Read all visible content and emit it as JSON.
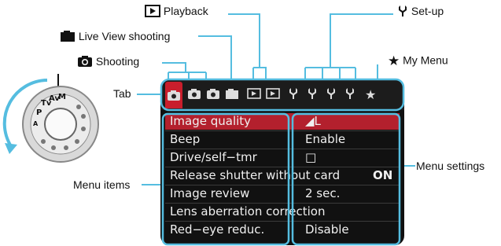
{
  "labels": {
    "playback": "Playback",
    "setup": "Set-up",
    "live_view": "Live View shooting",
    "shooting": "Shooting",
    "my_menu": "My Menu",
    "tab": "Tab",
    "menu_items": "Menu items",
    "menu_settings": "Menu settings"
  },
  "tabs": [
    {
      "icon": "camera-icon",
      "active": true
    },
    {
      "icon": "camera-icon"
    },
    {
      "icon": "camera-icon"
    },
    {
      "icon": "live-view-camera-icon"
    },
    {
      "icon": "playback-icon"
    },
    {
      "icon": "playback-icon"
    },
    {
      "icon": "wrench-icon"
    },
    {
      "icon": "wrench-icon"
    },
    {
      "icon": "wrench-icon"
    },
    {
      "icon": "wrench-icon"
    },
    {
      "icon": "star-icon"
    }
  ],
  "menu": [
    {
      "name": "Image quality",
      "value": "◢L"
    },
    {
      "name": "Beep",
      "value": "Enable"
    },
    {
      "name": "Drive/self−tmr",
      "value": "□"
    },
    {
      "name": "Release shutter without card",
      "value": "ON"
    },
    {
      "name": "Image review",
      "value": "2 sec."
    },
    {
      "name": "Lens aberration correction",
      "value": ""
    },
    {
      "name": "Red−eye reduc.",
      "value": "Disable"
    }
  ],
  "colors": {
    "callout": "#55bde0",
    "selected_row": "#b3202d",
    "screen_bg": "#111111"
  }
}
